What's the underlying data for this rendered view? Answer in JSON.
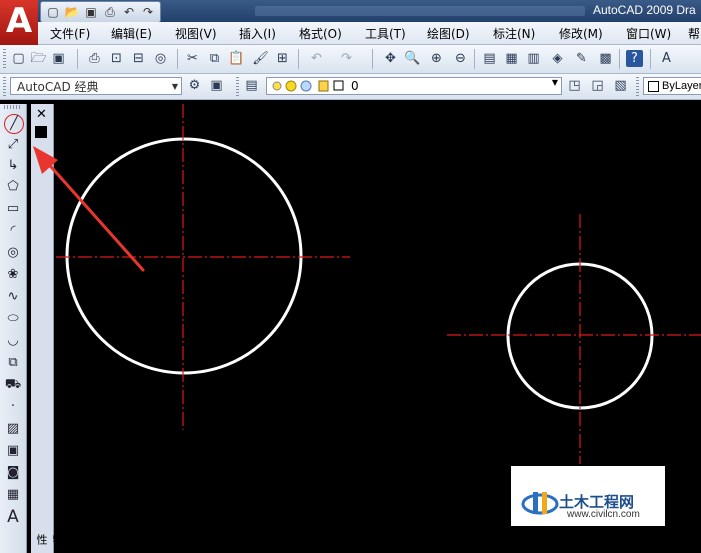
{
  "app": {
    "logo_letter": "A",
    "window_title": "AutoCAD 2009 Dra"
  },
  "quick_access": {
    "icons": [
      "new-icon",
      "open-icon",
      "save-icon",
      "print-icon",
      "undo-icon",
      "redo-icon"
    ]
  },
  "menu": {
    "items": [
      "文件(F)",
      "编辑(E)",
      "视图(V)",
      "插入(I)",
      "格式(O)",
      "工具(T)",
      "绘图(D)",
      "标注(N)",
      "修改(M)",
      "窗口(W)",
      "帮"
    ]
  },
  "workspace": {
    "value": "AutoCAD 经典"
  },
  "layer": {
    "value": "0"
  },
  "linetype": {
    "value": "ByLayer"
  },
  "palette": {
    "close_glyph": "✕",
    "label": "特性"
  },
  "draw_tools": [
    "line",
    "construction-line",
    "polyline",
    "polygon",
    "rectangle",
    "arc",
    "circle",
    "revision-cloud",
    "spline",
    "ellipse",
    "ellipse-arc",
    "insert-block",
    "make-block",
    "point",
    "hatch",
    "gradient",
    "region",
    "table",
    "multiline-text"
  ],
  "colors": {
    "background": "#000000",
    "circle": "#ffffff",
    "centerline": "#e01818",
    "annotation_arrow": "#e8352e"
  },
  "watermark": {
    "title": "土木工程网",
    "url": "www.civilcn.com"
  }
}
